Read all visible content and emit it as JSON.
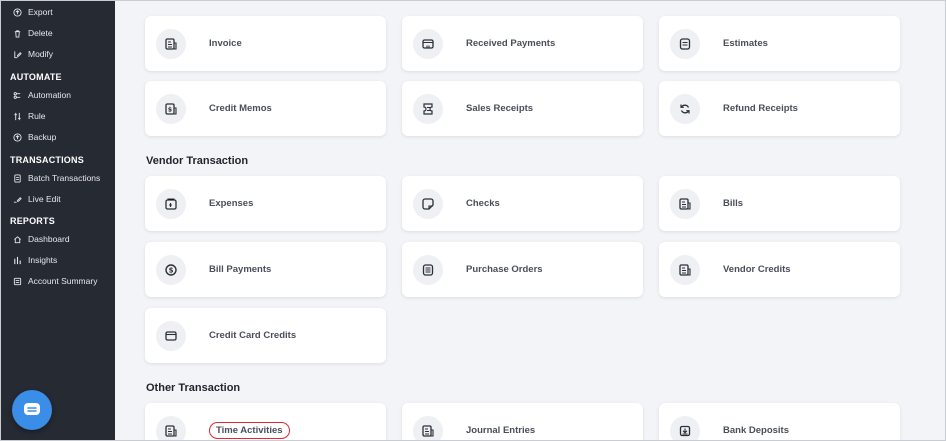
{
  "sidebar": {
    "top_items": [
      {
        "label": "Export",
        "icon": "upload-icon"
      },
      {
        "label": "Delete",
        "icon": "trash-icon"
      },
      {
        "label": "Modify",
        "icon": "edit-icon"
      }
    ],
    "sections": [
      {
        "title": "AUTOMATE",
        "items": [
          {
            "label": "Automation",
            "icon": "automation-icon"
          },
          {
            "label": "Rule",
            "icon": "rule-icon"
          },
          {
            "label": "Backup",
            "icon": "backup-icon"
          }
        ]
      },
      {
        "title": "TRANSACTIONS",
        "items": [
          {
            "label": "Batch Transactions",
            "icon": "document-icon"
          },
          {
            "label": "Live Edit",
            "icon": "live-edit-icon"
          }
        ]
      },
      {
        "title": "REPORTS",
        "items": [
          {
            "label": "Dashboard",
            "icon": "home-icon"
          },
          {
            "label": "Insights",
            "icon": "insights-icon"
          },
          {
            "label": "Account Summary",
            "icon": "summary-icon"
          }
        ]
      }
    ],
    "chat_icon": "chat-icon"
  },
  "main": {
    "customer_cards": [
      {
        "label": "Invoice",
        "icon": "invoice-icon"
      },
      {
        "label": "Received Payments",
        "icon": "wallet-icon"
      },
      {
        "label": "Estimates",
        "icon": "estimate-icon"
      },
      {
        "label": "Credit Memos",
        "icon": "credit-memo-icon"
      },
      {
        "label": "Sales Receipts",
        "icon": "receipt-icon"
      },
      {
        "label": "Refund Receipts",
        "icon": "refund-icon"
      }
    ],
    "vendor_section_title": "Vendor Transaction",
    "vendor_cards": [
      {
        "label": "Expenses",
        "icon": "expense-icon"
      },
      {
        "label": "Checks",
        "icon": "check-icon"
      },
      {
        "label": "Bills",
        "icon": "bill-icon"
      },
      {
        "label": "Bill Payments",
        "icon": "dollar-circle-icon"
      },
      {
        "label": "Purchase Orders",
        "icon": "purchase-order-icon"
      },
      {
        "label": "Vendor Credits",
        "icon": "vendor-credit-icon"
      },
      {
        "label": "Credit Card Credits",
        "icon": "credit-card-icon"
      }
    ],
    "other_section_title": "Other Transaction",
    "other_cards": [
      {
        "label": "Time Activities",
        "icon": "time-activity-icon",
        "highlighted": true
      },
      {
        "label": "Journal Entries",
        "icon": "journal-icon"
      },
      {
        "label": "Bank Deposits",
        "icon": "bank-deposit-icon"
      }
    ]
  },
  "colors": {
    "sidebar_bg": "#262a33",
    "page_bg": "#f3f4f7",
    "card_bg": "#ffffff",
    "chat_button": "#3b8ee8",
    "highlight": "#e3262f"
  }
}
